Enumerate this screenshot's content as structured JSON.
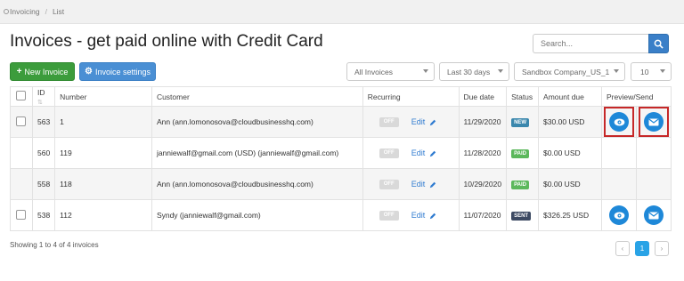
{
  "breadcrumb": {
    "items": [
      "Invoicing",
      "List"
    ]
  },
  "page": {
    "title": "Invoices - get paid online with Credit Card"
  },
  "search": {
    "placeholder": "Search..."
  },
  "toolbar": {
    "new_invoice": "New Invoice",
    "invoice_settings": "Invoice settings",
    "filter_status": "All Invoices",
    "filter_period": "Last 30 days",
    "filter_company": "Sandbox Company_US_1",
    "page_size": "10"
  },
  "table": {
    "columns": [
      "ID",
      "Number",
      "Customer",
      "Recurring",
      "Due date",
      "Status",
      "Amount due",
      "Preview/Send"
    ],
    "rows": [
      {
        "id": "563",
        "number": "1",
        "customer": "Ann (ann.lomonosova@cloudbusinesshq.com)",
        "recurring": "OFF",
        "edit": "Edit",
        "due": "11/29/2020",
        "status": "NEW",
        "amount": "$30.00 USD"
      },
      {
        "id": "560",
        "number": "119",
        "customer": "janniewalf@gmail.com (USD) (janniewalf@gmail.com)",
        "recurring": "OFF",
        "edit": "Edit",
        "due": "11/28/2020",
        "status": "PAID",
        "amount": "$0.00 USD"
      },
      {
        "id": "558",
        "number": "118",
        "customer": "Ann (ann.lomonosova@cloudbusinesshq.com)",
        "recurring": "OFF",
        "edit": "Edit",
        "due": "10/29/2020",
        "status": "PAID",
        "amount": "$0.00 USD"
      },
      {
        "id": "538",
        "number": "112",
        "customer": "Syndy (janniewalf@gmail.com)",
        "recurring": "OFF",
        "edit": "Edit",
        "due": "11/07/2020",
        "status": "SENT",
        "amount": "$326.25 USD"
      }
    ]
  },
  "footer": {
    "summary": "Showing 1 to 4 of 4 invoices",
    "pagination": {
      "prev": "‹",
      "current": "1",
      "next": "›"
    }
  },
  "colors": {
    "new": "#3a87ad",
    "paid": "#5cb85c",
    "sent": "#3d4a63",
    "highlight": "#c62828",
    "action": "#1e88d8"
  },
  "icons": [
    "home-icon",
    "search-icon",
    "plus-icon",
    "gear-icon",
    "chevron-down-icon",
    "pencil-icon",
    "eye-icon",
    "envelope-icon"
  ]
}
